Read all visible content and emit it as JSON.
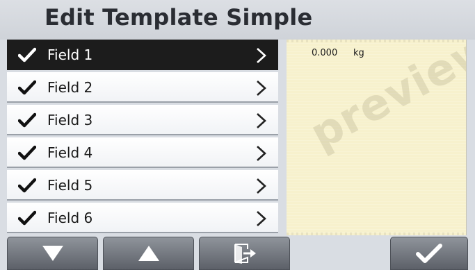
{
  "title": "Edit Template Simple",
  "fields": [
    {
      "label": "Field 1",
      "checked": true,
      "selected": true
    },
    {
      "label": "Field 2",
      "checked": true,
      "selected": false
    },
    {
      "label": "Field 3",
      "checked": true,
      "selected": false
    },
    {
      "label": "Field 4",
      "checked": true,
      "selected": false
    },
    {
      "label": "Field 5",
      "checked": true,
      "selected": false
    },
    {
      "label": "Field 6",
      "checked": true,
      "selected": false
    }
  ],
  "preview": {
    "value": "0.000",
    "unit": "kg",
    "watermark": "preview"
  },
  "toolbar": {
    "buttons": [
      "down-arrow-icon",
      "up-arrow-icon",
      "exit-icon",
      "accept-check-icon"
    ]
  },
  "colors": {
    "selected_row": "#1c1c1c",
    "preview_paper": "#f7f1cd",
    "button": "#6f747b"
  }
}
